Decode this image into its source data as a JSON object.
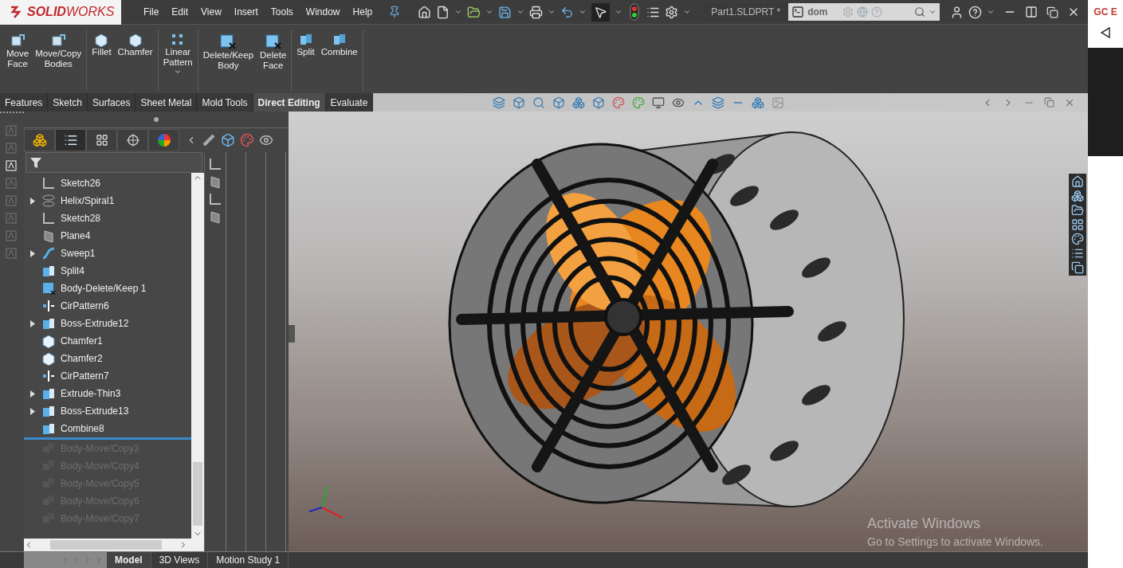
{
  "title_bar": {
    "logo": "**SOLID**WORKS",
    "menu": [
      "File",
      "Edit",
      "View",
      "Insert",
      "Tools",
      "Window",
      "Help"
    ],
    "document_title": "Part1.SLDPRT *",
    "search": {
      "value": "dom"
    }
  },
  "ribbon": {
    "groups": [
      [
        {
          "lines": [
            "Move",
            "Face"
          ],
          "kind": "move-face"
        },
        {
          "lines": [
            "Move/Copy",
            "Bodies"
          ],
          "kind": "move-copy"
        }
      ],
      [
        {
          "lines": [
            "Fillet"
          ],
          "kind": "fillet"
        },
        {
          "lines": [
            "Chamfer"
          ],
          "kind": "chamfer"
        }
      ],
      [
        {
          "lines": [
            "Linear",
            "Pattern"
          ],
          "kind": "pattern",
          "dropdown": true
        }
      ],
      [
        {
          "lines": [
            "Delete/Keep",
            "Body"
          ],
          "kind": "delete-body"
        },
        {
          "lines": [
            "Delete",
            "Face"
          ],
          "kind": "delete-face"
        }
      ],
      [
        {
          "lines": [
            "Split"
          ],
          "kind": "split"
        },
        {
          "lines": [
            "Combine"
          ],
          "kind": "combine"
        }
      ]
    ]
  },
  "command_tabs": [
    {
      "label": "Features",
      "selected": false
    },
    {
      "label": "Sketch",
      "selected": false
    },
    {
      "label": "Surfaces",
      "selected": false
    },
    {
      "label": "Sheet Metal",
      "selected": false
    },
    {
      "label": "Mold Tools",
      "selected": false
    },
    {
      "label": "Direct Editing",
      "selected": true
    },
    {
      "label": "Evaluate",
      "selected": false
    }
  ],
  "feature_tree": {
    "panel_tabs": [
      {
        "kind": "part",
        "selected": false
      },
      {
        "kind": "tree",
        "selected": true
      },
      {
        "kind": "config",
        "selected": false
      },
      {
        "kind": "target",
        "selected": false
      },
      {
        "kind": "appearance",
        "selected": false
      }
    ],
    "items": [
      {
        "name": "Sketch26",
        "kind": "sketch",
        "expandable": false,
        "rolled_back": false
      },
      {
        "name": "Helix/Spiral1",
        "kind": "helix",
        "expandable": true,
        "rolled_back": false
      },
      {
        "name": "Sketch28",
        "kind": "sketch",
        "expandable": false,
        "rolled_back": false
      },
      {
        "name": "Plane4",
        "kind": "plane",
        "expandable": false,
        "rolled_back": false
      },
      {
        "name": "Sweep1",
        "kind": "sweep",
        "expandable": true,
        "rolled_back": false
      },
      {
        "name": "Split4",
        "kind": "split",
        "expandable": false,
        "rolled_back": false
      },
      {
        "name": "Body-Delete/Keep 1",
        "kind": "delete-body",
        "expandable": false,
        "rolled_back": false
      },
      {
        "name": "CirPattern6",
        "kind": "pattern",
        "expandable": false,
        "rolled_back": false
      },
      {
        "name": "Boss-Extrude12",
        "kind": "extrude",
        "expandable": true,
        "rolled_back": false
      },
      {
        "name": "Chamfer1",
        "kind": "chamfer",
        "expandable": false,
        "rolled_back": false
      },
      {
        "name": "Chamfer2",
        "kind": "chamfer",
        "expandable": false,
        "rolled_back": false
      },
      {
        "name": "CirPattern7",
        "kind": "pattern",
        "expandable": false,
        "rolled_back": false
      },
      {
        "name": "Extrude-Thin3",
        "kind": "extrude",
        "expandable": true,
        "rolled_back": false
      },
      {
        "name": "Boss-Extrude13",
        "kind": "extrude",
        "expandable": true,
        "rolled_back": false
      },
      {
        "name": "Combine8",
        "kind": "combine",
        "expandable": false,
        "rolled_back": false
      },
      {
        "name": "Body-Move/Copy3",
        "kind": "move-copy",
        "expandable": false,
        "rolled_back": true
      },
      {
        "name": "Body-Move/Copy4",
        "kind": "move-copy",
        "expandable": false,
        "rolled_back": true
      },
      {
        "name": "Body-Move/Copy5",
        "kind": "move-copy",
        "expandable": false,
        "rolled_back": true
      },
      {
        "name": "Body-Move/Copy6",
        "kind": "move-copy",
        "expandable": false,
        "rolled_back": true
      },
      {
        "name": "Body-Move/Copy7",
        "kind": "move-copy",
        "expandable": false,
        "rolled_back": true
      }
    ]
  },
  "bottom_tabs": [
    {
      "label": "Model",
      "selected": true
    },
    {
      "label": "3D Views",
      "selected": false
    },
    {
      "label": "Motion Study 1",
      "selected": false
    }
  ],
  "activation_notice": {
    "title": "Activate Windows",
    "message": "Go to Settings to activate Windows."
  },
  "side_strip": {
    "label": "GC E"
  }
}
